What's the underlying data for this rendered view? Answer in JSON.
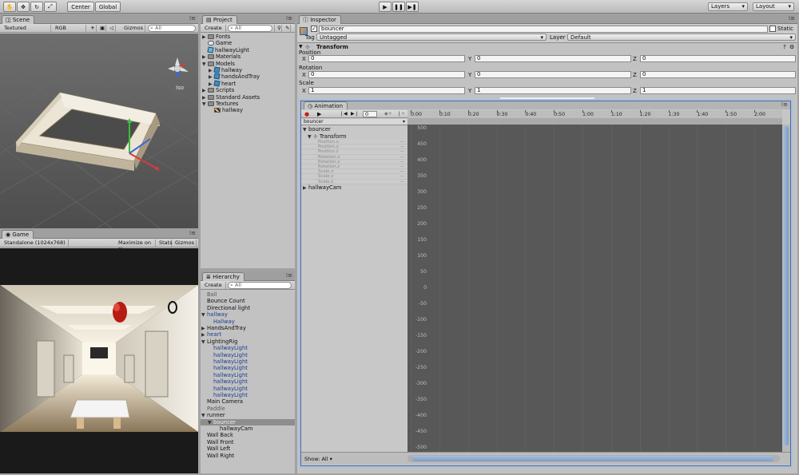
{
  "toolbar": {
    "tools": [
      "hand-tool",
      "move-tool",
      "rotate-tool",
      "scale-tool"
    ],
    "pivot_center": "Center",
    "pivot_global": "Global",
    "layers": "Layers",
    "layout": "Layout"
  },
  "scene": {
    "tab": "Scene",
    "render_mode": "Textured",
    "color_mode": "RGB",
    "gizmos": "Gizmos",
    "search": "All",
    "persp_label": "Iso"
  },
  "game": {
    "tab": "Game",
    "resolution": "Standalone (1024x768)",
    "maximize": "Maximize on Play",
    "stats": "Stats",
    "gizmos": "Gizmos"
  },
  "project": {
    "tab": "Project",
    "create": "Create",
    "search": "All",
    "items": [
      {
        "label": "Fonts",
        "depth": 0,
        "kind": "folder",
        "fold": "▶"
      },
      {
        "label": "Game",
        "depth": 0,
        "kind": "scene",
        "fold": ""
      },
      {
        "label": "hallwayLight",
        "depth": 0,
        "kind": "prefab",
        "fold": ""
      },
      {
        "label": "Materials",
        "depth": 0,
        "kind": "folder",
        "fold": "▶"
      },
      {
        "label": "Models",
        "depth": 0,
        "kind": "folder",
        "fold": "▼"
      },
      {
        "label": "hallway",
        "depth": 1,
        "kind": "model",
        "fold": "▶"
      },
      {
        "label": "handsAndTray",
        "depth": 1,
        "kind": "model",
        "fold": "▶"
      },
      {
        "label": "heart",
        "depth": 1,
        "kind": "model",
        "fold": "▶"
      },
      {
        "label": "Scripts",
        "depth": 0,
        "kind": "folder",
        "fold": "▶"
      },
      {
        "label": "Standard Assets",
        "depth": 0,
        "kind": "folder",
        "fold": "▶"
      },
      {
        "label": "Textures",
        "depth": 0,
        "kind": "folder",
        "fold": "▼"
      },
      {
        "label": "hallway",
        "depth": 1,
        "kind": "texture",
        "fold": ""
      }
    ]
  },
  "hierarchy": {
    "tab": "Hierarchy",
    "create": "Create",
    "search": "All",
    "items": [
      {
        "label": "Ball",
        "depth": 0,
        "fold": "",
        "style": "gray"
      },
      {
        "label": "Bounce Count",
        "depth": 0,
        "fold": "",
        "style": ""
      },
      {
        "label": "Directional light",
        "depth": 0,
        "fold": "",
        "style": ""
      },
      {
        "label": "hallway",
        "depth": 0,
        "fold": "▼",
        "style": "blue"
      },
      {
        "label": "Hallway",
        "depth": 1,
        "fold": "",
        "style": "blue"
      },
      {
        "label": "HandsAndTray",
        "depth": 0,
        "fold": "▶",
        "style": ""
      },
      {
        "label": "heart",
        "depth": 0,
        "fold": "▶",
        "style": "blue"
      },
      {
        "label": "LightingRig",
        "depth": 0,
        "fold": "▼",
        "style": ""
      },
      {
        "label": "hallwayLight",
        "depth": 1,
        "fold": "",
        "style": "blue"
      },
      {
        "label": "hallwayLight",
        "depth": 1,
        "fold": "",
        "style": "blue"
      },
      {
        "label": "hallwayLight",
        "depth": 1,
        "fold": "",
        "style": "blue"
      },
      {
        "label": "hallwayLight",
        "depth": 1,
        "fold": "",
        "style": "blue"
      },
      {
        "label": "hallwayLight",
        "depth": 1,
        "fold": "",
        "style": "blue"
      },
      {
        "label": "hallwayLight",
        "depth": 1,
        "fold": "",
        "style": "blue"
      },
      {
        "label": "hallwayLight",
        "depth": 1,
        "fold": "",
        "style": "blue"
      },
      {
        "label": "hallwayLight",
        "depth": 1,
        "fold": "",
        "style": "blue"
      },
      {
        "label": "Main Camera",
        "depth": 0,
        "fold": "",
        "style": ""
      },
      {
        "label": "Paddle",
        "depth": 0,
        "fold": "",
        "style": "gray"
      },
      {
        "label": "runner",
        "depth": 0,
        "fold": "▼",
        "style": ""
      },
      {
        "label": "bouncer",
        "depth": 1,
        "fold": "▼",
        "style": "selected"
      },
      {
        "label": "hallwayCam",
        "depth": 2,
        "fold": "",
        "style": ""
      },
      {
        "label": "Wall Back",
        "depth": 0,
        "fold": "",
        "style": ""
      },
      {
        "label": "Wall Front",
        "depth": 0,
        "fold": "",
        "style": ""
      },
      {
        "label": "Wall Left",
        "depth": 0,
        "fold": "",
        "style": ""
      },
      {
        "label": "Wall Right",
        "depth": 0,
        "fold": "",
        "style": ""
      }
    ]
  },
  "inspector": {
    "tab": "Inspector",
    "object_name": "bouncer",
    "static": "Static",
    "tag_label": "Tag",
    "tag_value": "Untagged",
    "layer_label": "Layer",
    "layer_value": "Default",
    "component": "Transform",
    "position_label": "Position",
    "rotation_label": "Rotation",
    "scale_label": "Scale",
    "axis_x": "X",
    "axis_y": "Y",
    "axis_z": "Z",
    "position": [
      "0",
      "0",
      "0"
    ],
    "rotation": [
      "0",
      "0",
      "0"
    ],
    "scale": [
      "1",
      "1",
      "1"
    ]
  },
  "animation": {
    "tab": "Animation",
    "frame": "0",
    "clip": "bouncer",
    "root": "bouncer",
    "component": "Transform",
    "properties": [
      "Position.x",
      "Position.y",
      "Position.z",
      "Rotation.x",
      "Rotation.y",
      "Rotation.z",
      "Scale.x",
      "Scale.y",
      "Scale.z"
    ],
    "child": "hallwayCam",
    "show": "Show: All",
    "timeline": [
      "0:00",
      "0:10",
      "0:20",
      "0:30",
      "0:40",
      "0:50",
      "1:00",
      "1:10",
      "1:20",
      "1:30",
      "1:40",
      "1:50",
      "2:00"
    ],
    "yticks": [
      "500",
      "450",
      "400",
      "350",
      "300",
      "250",
      "200",
      "150",
      "100",
      "50",
      "0",
      "-50",
      "-100",
      "-150",
      "-200",
      "-250",
      "-300",
      "-350",
      "-400",
      "-450",
      "-500"
    ]
  }
}
